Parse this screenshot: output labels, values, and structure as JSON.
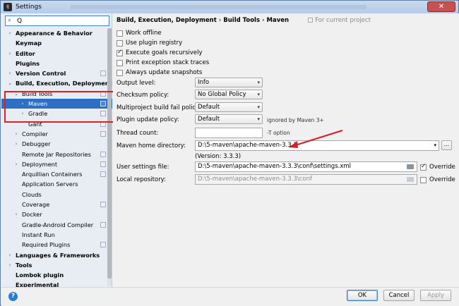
{
  "window": {
    "title": "Settings",
    "close_label": "✕"
  },
  "search": {
    "value": "Q",
    "placeholder": ""
  },
  "tree": [
    {
      "label": "Appearance & Behavior",
      "arrow": "›",
      "bold": true,
      "indent": 0,
      "proj": false
    },
    {
      "label": "Keymap",
      "arrow": "",
      "bold": true,
      "indent": 0,
      "proj": false
    },
    {
      "label": "Editor",
      "arrow": "›",
      "bold": true,
      "indent": 0,
      "proj": false
    },
    {
      "label": "Plugins",
      "arrow": "",
      "bold": true,
      "indent": 0,
      "proj": false
    },
    {
      "label": "Version Control",
      "arrow": "›",
      "bold": true,
      "indent": 0,
      "proj": true
    },
    {
      "label": "Build, Execution, Deployment",
      "arrow": "⌄",
      "bold": true,
      "indent": 0,
      "proj": false
    },
    {
      "label": "Build Tools",
      "arrow": "⌄",
      "bold": false,
      "indent": 1,
      "proj": true
    },
    {
      "label": "Maven",
      "arrow": "›",
      "bold": false,
      "indent": 2,
      "proj": true,
      "selected": true
    },
    {
      "label": "Gradle",
      "arrow": "›",
      "bold": false,
      "indent": 2,
      "proj": true
    },
    {
      "label": "Gant",
      "arrow": "",
      "bold": false,
      "indent": 2,
      "proj": true
    },
    {
      "label": "Compiler",
      "arrow": "›",
      "bold": false,
      "indent": 1,
      "proj": true
    },
    {
      "label": "Debugger",
      "arrow": "›",
      "bold": false,
      "indent": 1,
      "proj": false
    },
    {
      "label": "Remote Jar Repositories",
      "arrow": "",
      "bold": false,
      "indent": 1,
      "proj": true
    },
    {
      "label": "Deployment",
      "arrow": "›",
      "bold": false,
      "indent": 1,
      "proj": true
    },
    {
      "label": "Arquillian Containers",
      "arrow": "",
      "bold": false,
      "indent": 1,
      "proj": true
    },
    {
      "label": "Application Servers",
      "arrow": "",
      "bold": false,
      "indent": 1,
      "proj": false
    },
    {
      "label": "Clouds",
      "arrow": "",
      "bold": false,
      "indent": 1,
      "proj": false
    },
    {
      "label": "Coverage",
      "arrow": "",
      "bold": false,
      "indent": 1,
      "proj": true
    },
    {
      "label": "Docker",
      "arrow": "›",
      "bold": false,
      "indent": 1,
      "proj": false
    },
    {
      "label": "Gradle-Android Compiler",
      "arrow": "",
      "bold": false,
      "indent": 1,
      "proj": true
    },
    {
      "label": "Instant Run",
      "arrow": "",
      "bold": false,
      "indent": 1,
      "proj": false
    },
    {
      "label": "Required Plugins",
      "arrow": "",
      "bold": false,
      "indent": 1,
      "proj": true
    },
    {
      "label": "Languages & Frameworks",
      "arrow": "›",
      "bold": true,
      "indent": 0,
      "proj": false
    },
    {
      "label": "Tools",
      "arrow": "›",
      "bold": true,
      "indent": 0,
      "proj": false
    },
    {
      "label": "Lombok plugin",
      "arrow": "",
      "bold": true,
      "indent": 0,
      "proj": false
    },
    {
      "label": "Experimental",
      "arrow": "",
      "bold": true,
      "indent": 0,
      "proj": false
    }
  ],
  "breadcrumb": {
    "part1": "Build, Execution, Deployment",
    "part2": "Build Tools",
    "part3": "Maven",
    "separator": "›",
    "project_note": "For current project"
  },
  "options": {
    "work_offline": {
      "label": "Work offline",
      "checked": false
    },
    "use_plugin_registry": {
      "label": "Use plugin registry",
      "checked": false
    },
    "execute_goals_recursively": {
      "label": "Execute goals recursively",
      "checked": true
    },
    "print_exception_stack_traces": {
      "label": "Print exception stack traces",
      "checked": false
    },
    "always_update_snapshots": {
      "label": "Always update snapshots",
      "checked": false
    }
  },
  "fields": {
    "output_level": {
      "label": "Output level:",
      "value": "Info"
    },
    "checksum_policy": {
      "label": "Checksum policy:",
      "value": "No Global Policy"
    },
    "multiproject_fail_policy": {
      "label": "Multiproject build fail policy:",
      "value": "Default"
    },
    "plugin_update_policy": {
      "label": "Plugin update policy:",
      "value": "Default",
      "note": "ignored by Maven 3+"
    },
    "thread_count": {
      "label": "Thread count:",
      "value": "",
      "note": "-T option"
    },
    "maven_home": {
      "label": "Maven home directory:",
      "value": "D:\\5-maven\\apache-maven-3.3.3",
      "browse": "..."
    },
    "version": "(Version: 3.3.3)",
    "user_settings": {
      "label": "User settings file:",
      "value": "D:\\5-maven\\apache-maven-3.3.3\\conf\\settings.xml",
      "override_label": "Override",
      "override_checked": true
    },
    "local_repo": {
      "label": "Local repository:",
      "value": "D:\\5-maven\\apache-maven-3.3.3\\conf",
      "override_label": "Override",
      "override_checked": false
    }
  },
  "buttons": {
    "ok": "OK",
    "cancel": "Cancel",
    "apply": "Apply",
    "help": "?"
  },
  "colors": {
    "selection": "#2d6fc4",
    "highlight_box": "#e02020",
    "annotation_arrow": "#d0202a"
  }
}
